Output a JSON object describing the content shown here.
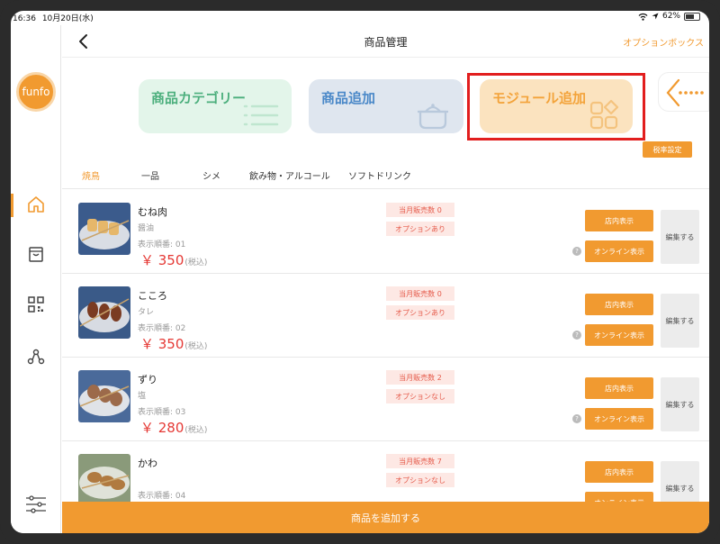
{
  "status": {
    "time": "16:36",
    "date": "10月20日(水)",
    "battery": "62%",
    "battery_fraction": 0.62
  },
  "logo": {
    "text": "funfo"
  },
  "header": {
    "title": "商品管理",
    "option_link": "オプションボックス"
  },
  "cards": [
    {
      "label": "商品カテゴリー",
      "icon": "list-icon"
    },
    {
      "label": "商品追加",
      "icon": "pot-icon"
    },
    {
      "label": "モジュール追加",
      "icon": "modules-icon"
    }
  ],
  "tax_button": "税率設定",
  "tabs": [
    "焼鳥",
    "一品",
    "シメ",
    "飲み物・アルコール",
    "ソフトドリンク"
  ],
  "products": [
    {
      "name": "むね肉",
      "sauce": "醤油",
      "order": "表示順番: 01",
      "price": "￥ 350",
      "tax": "(税込)",
      "sales": "当月販売数 0",
      "option": "オプションあり"
    },
    {
      "name": "こころ",
      "sauce": "タレ",
      "order": "表示順番: 02",
      "price": "￥ 350",
      "tax": "(税込)",
      "sales": "当月販売数 0",
      "option": "オプションあり"
    },
    {
      "name": "ずり",
      "sauce": "塩",
      "order": "表示順番: 03",
      "price": "￥ 280",
      "tax": "(税込)",
      "sales": "当月販売数 2",
      "option": "オプションなし"
    },
    {
      "name": "かわ",
      "sauce": "",
      "order": "表示順番: 04",
      "price": "",
      "tax": "",
      "sales": "当月販売数 7",
      "option": "オプションなし"
    }
  ],
  "row_buttons": {
    "store": "店内表示",
    "online": "オンライン表示",
    "edit": "編集する",
    "help": "?"
  },
  "add_button": "商品を追加する"
}
